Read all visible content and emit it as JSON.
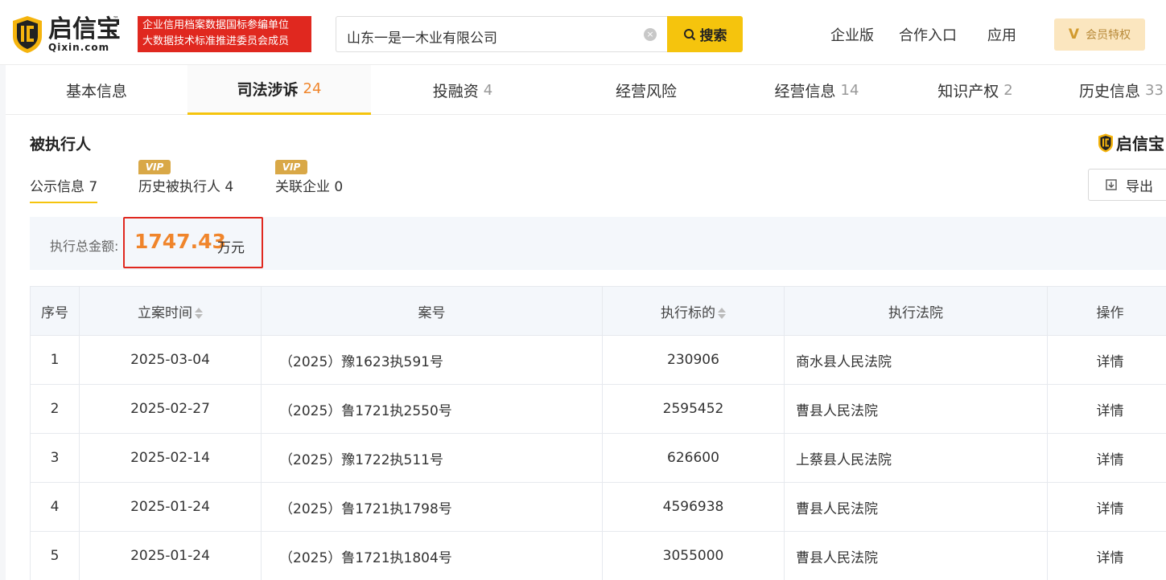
{
  "brand": {
    "name_cn": "启信宝",
    "name_en": "Qixin.com",
    "tm": "™"
  },
  "banner": {
    "line1": "企业信用档案数据国标参编单位",
    "line2": "大数据技术标准推进委员会成员"
  },
  "search": {
    "value": "山东一是一木业有限公司",
    "button_label": "搜索",
    "clear_glyph": "×"
  },
  "topnav": {
    "enterprise": "企业版",
    "cooperation": "合作入口",
    "apps": "应用",
    "vip_label": "会员特权",
    "vip_glyph": "V"
  },
  "tabs": [
    {
      "label": "基本信息",
      "count": ""
    },
    {
      "label": "司法涉诉",
      "count": "24"
    },
    {
      "label": "投融资",
      "count": "4"
    },
    {
      "label": "经营风险",
      "count": ""
    },
    {
      "label": "经营信息",
      "count": "14"
    },
    {
      "label": "知识产权",
      "count": "2"
    },
    {
      "label": "历史信息",
      "count": "33"
    }
  ],
  "section": {
    "title": "被执行人",
    "watermark": "启信宝",
    "subtabs": [
      {
        "label": "公示信息 7",
        "vip": ""
      },
      {
        "label": "历史被执行人 4",
        "vip": "VIP"
      },
      {
        "label": "关联企业 0",
        "vip": "VIP"
      }
    ],
    "export_label": "导出",
    "summary_label": "执行总金额:",
    "summary_value": "1747.43",
    "summary_unit": "万元"
  },
  "table": {
    "headers": [
      "序号",
      "立案时间",
      "案号",
      "执行标的",
      "执行法院",
      "操作"
    ],
    "rows": [
      {
        "no": "1",
        "date": "2025-03-04",
        "case": "（2025）豫1623执591号",
        "amount": "230906",
        "court": "商水县人民法院",
        "action": "详情"
      },
      {
        "no": "2",
        "date": "2025-02-27",
        "case": "（2025）鲁1721执2550号",
        "amount": "2595452",
        "court": "曹县人民法院",
        "action": "详情"
      },
      {
        "no": "3",
        "date": "2025-02-14",
        "case": "（2025）豫1722执511号",
        "amount": "626600",
        "court": "上蔡县人民法院",
        "action": "详情"
      },
      {
        "no": "4",
        "date": "2025-01-24",
        "case": "（2025）鲁1721执1798号",
        "amount": "4596938",
        "court": "曹县人民法院",
        "action": "详情"
      },
      {
        "no": "5",
        "date": "2025-01-24",
        "case": "（2025）鲁1721执1804号",
        "amount": "3055000",
        "court": "曹县人民法院",
        "action": "详情"
      }
    ]
  },
  "colors": {
    "accent": "#f5c40d",
    "brand_red": "#e0281f",
    "amount": "#e0492b",
    "link": "#2d6fcc",
    "count_active": "#f0852b"
  }
}
